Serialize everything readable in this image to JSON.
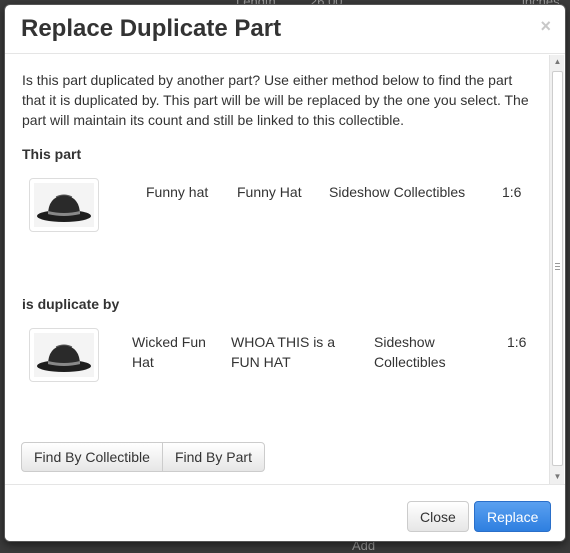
{
  "background": {
    "peek_texts": [
      "Length",
      "26.00",
      "inches",
      "Add"
    ]
  },
  "modal": {
    "title": "Replace Duplicate Part",
    "close_glyph": "×",
    "intro": "Is this part duplicated by another part? Use either method below to find the part that it is duplicated by. This part will be will be replaced by the one you select. The part will maintain its count and still be linked to this collectible.",
    "this_part": {
      "label": "This part",
      "image_icon": "fedora-hat-image",
      "name": "Funny hat",
      "description": "Funny Hat",
      "manufacturer": "Sideshow Collectibles",
      "scale": "1:6"
    },
    "duplicate_by": {
      "label": "is duplicate by",
      "image_icon": "fedora-hat-image",
      "name": "Wicked Fun Hat",
      "description": "WHOA THIS is a FUN HAT",
      "manufacturer": "Sideshow Collectibles",
      "scale": "1:6"
    },
    "find_buttons": [
      "Find By Collectible",
      "Find By Part"
    ],
    "footer": {
      "close_label": "Close",
      "replace_label": "Replace"
    }
  },
  "colors": {
    "primary": "#2e7fe0",
    "backdrop": "#3a3a3a"
  }
}
